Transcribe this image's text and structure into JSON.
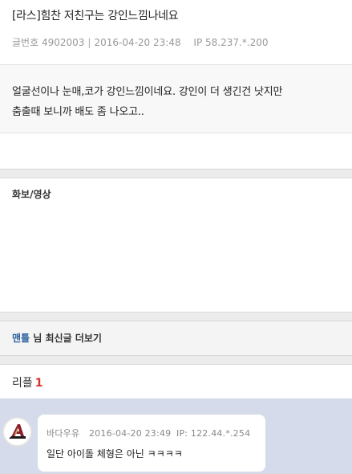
{
  "post": {
    "title": "[라스]힘찬 저친구는 강인느낌나네요",
    "number_label": "글번호",
    "number": "4902003",
    "date": "2016-04-20 23:48",
    "ip_label": "IP",
    "ip": "58.237.*.200",
    "body_line1": "얼굴선이나 눈매,코가 강인느낌이네요. 강인이 더 생긴건 낫지만",
    "body_line2": "춤출때 보니까 배도 좀 나오고.."
  },
  "media": {
    "title": "화보/영상"
  },
  "more": {
    "nick": "맨틀",
    "suffix": " 님 최신글 더보기"
  },
  "replies": {
    "label": "리플",
    "count": "1",
    "items": [
      {
        "nick": "바다우유",
        "date": "2016-04-20 23:49",
        "ip": "IP: 122.44.*.254",
        "text": "일단 아이돌 체형은 아닌 ㅋㅋㅋㅋ",
        "avatar_icon": "arizona-a-logo-icon"
      }
    ]
  },
  "colors": {
    "accent": "#d0342c",
    "nick": "#2b5f9e",
    "reply_bg": "#d6dbeb"
  }
}
